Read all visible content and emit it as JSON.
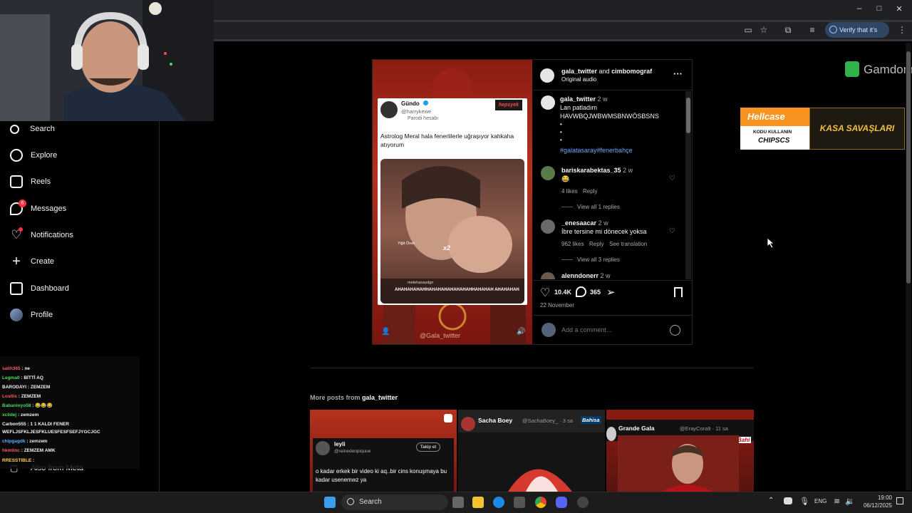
{
  "browser": {
    "verify_label": "Verify that it's you",
    "window_controls": {
      "minimize": "–",
      "maximize": "□",
      "close": "✕"
    }
  },
  "sidebar": {
    "items": [
      {
        "label": "Search",
        "icon": "search-icon"
      },
      {
        "label": "Explore",
        "icon": "compass-icon"
      },
      {
        "label": "Reels",
        "icon": "reels-icon"
      },
      {
        "label": "Messages",
        "icon": "messenger-icon",
        "badge": "6"
      },
      {
        "label": "Notifications",
        "icon": "heart-icon"
      },
      {
        "label": "Create",
        "icon": "plus-icon"
      },
      {
        "label": "Dashboard",
        "icon": "dashboard-icon"
      },
      {
        "label": "Profile",
        "icon": "avatar"
      }
    ],
    "also_from_meta": "Also from Meta"
  },
  "chat": [
    {
      "user": "salih365",
      "msg": ": ne",
      "color": "#ff5a5a"
    },
    {
      "user": "Legma0",
      "msg": ": BİTTİ AQ",
      "color": "#4cd964"
    },
    {
      "user": "BARODAYI",
      "msg": ": ZEMZEM",
      "color": "#f2f2f2"
    },
    {
      "user": "Lostlix",
      "msg": ": ZEMZEM",
      "color": "#ff5a5a"
    },
    {
      "user": "Babaninyo58",
      "msg": ": 😂😂😂",
      "color": "#4cd964"
    },
    {
      "user": "xclidej",
      "msg": ": zemzem",
      "color": "#4cd964"
    },
    {
      "user": "Carbon555",
      "msg": ": 1 1 KALDI FENER",
      "color": "#f2f2f2"
    },
    {
      "user": "",
      "msg": "WEFLJSFKLJESFKLUESFESFSEFJYGCJGC",
      "color": "#f2f2f2"
    },
    {
      "user": "chipgagdk",
      "msg": ": zemzem",
      "color": "#5ab0ff"
    },
    {
      "user": "hkmtinc",
      "msg": ": ZEMZEM AMK",
      "color": "#ff5a5a"
    },
    {
      "user": "RRESSTIBLE",
      "msg": ":",
      "color": "#ffd34d"
    }
  ],
  "post": {
    "tweet": {
      "name": "Gündo",
      "handle": "@harrykewe",
      "parody": "Parodi hesabı",
      "text": "Astrolog Meral hala fenerlilerle uğraşıyor kahkaha atıyorum",
      "logo": "hepsyek",
      "overlay_user": "Yiğit Öner",
      "overlay_mult": "x2",
      "comment_user": "metehanaydgn",
      "comment_text": "AHAHAHAHAHHAHAHAHAHAHAHAHHAHAHAH AHAHAHAH"
    },
    "watermark": "@Gala_twitter",
    "header": {
      "user": "gala_twitter",
      "and": "and",
      "collab": "cimbomograf",
      "audio": "Original audio"
    },
    "caption": {
      "user": "gala_twitter",
      "time": "2 w",
      "line1": "Lan patladım",
      "line2": "HAVWBQJWBWMSBNWÖSBSNS",
      "dots": [
        "•",
        "•",
        "•"
      ],
      "hashtags": "#galatasaray#fenerbahçe"
    },
    "comments": [
      {
        "user": "bariskarabektas_35",
        "time": "2 w",
        "text": "😂",
        "likes": "4 likes",
        "reply": "Reply",
        "view": "View all 1 replies",
        "translate": ""
      },
      {
        "user": "_enesaacar",
        "time": "2 w",
        "text": "İbre tersine mi dönecek yoksa",
        "likes": "962 likes",
        "reply": "Reply",
        "view": "View all 3 replies",
        "translate": "See translation"
      },
      {
        "user": "alenndonerr",
        "time": "2 w",
        "text": "",
        "likes": "",
        "reply": "",
        "view": "",
        "translate": ""
      }
    ],
    "likes": "10.4K",
    "comment_count": "365",
    "date": "22 November",
    "add_comment": "Add a comment..."
  },
  "more_posts": {
    "label": "More posts from",
    "user": "gala_twitter",
    "thumbs": [
      {
        "name": "leyli",
        "handle": "@reinedenpiquue",
        "follow": "Takip et",
        "text": "o kadar erkek bir video ki aq..bir cins konuşmaya bu kadar usenemwz ya"
      },
      {
        "name": "Sacha Boey",
        "handle": "@SachaBoey_ · 3 sa",
        "brand": "Bahisa"
      },
      {
        "name": "Grande Gala",
        "handle": "@ErayCora9 · 11 sa",
        "brand": "Bahi"
      }
    ]
  },
  "ads": {
    "gamdom": "Gamdom",
    "hellcase": "Hellcase",
    "code_line1": "KODU KULLANIN",
    "code_line2": "CHIPSCS",
    "battle": "KASA SAVAŞLARI"
  },
  "taskbar": {
    "search": "Search",
    "lang": "ENG",
    "time": "19:00",
    "date": "06/12/2025"
  },
  "colors": {
    "accent": "#0095f6",
    "hashtag": "#6ea8ff",
    "badge": "#ff3040",
    "hellcase_orange": "#f7931e",
    "gamdom_green": "#2fb34a"
  }
}
